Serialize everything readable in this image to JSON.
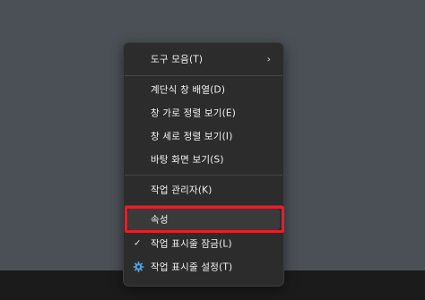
{
  "context_menu": {
    "items": [
      {
        "label": "도구 모음(T)",
        "has_submenu": true,
        "submenu_icon": "chevron-right-icon"
      },
      {
        "label": "계단식 창 배열(D)"
      },
      {
        "label": "창 가로 정렬 보기(E)"
      },
      {
        "label": "창 세로 정렬 보기(I)"
      },
      {
        "label": "바탕 화면 보기(S)"
      },
      {
        "label": "작업 관리자(K)"
      },
      {
        "label": "속성",
        "highlighted": true
      },
      {
        "label": "작업 표시줄 잠금(L)",
        "checked": true,
        "icon": "checkmark-icon"
      },
      {
        "label": "작업 표시줄 설정(T)",
        "icon": "gear-icon"
      }
    ]
  },
  "colors": {
    "menu_background": "#2c2c2c",
    "desktop_background": "#4b5056",
    "taskbar_background": "#1b1b1b",
    "highlight_box": "#e0202a",
    "gear_accent": "#4fa3e6"
  }
}
